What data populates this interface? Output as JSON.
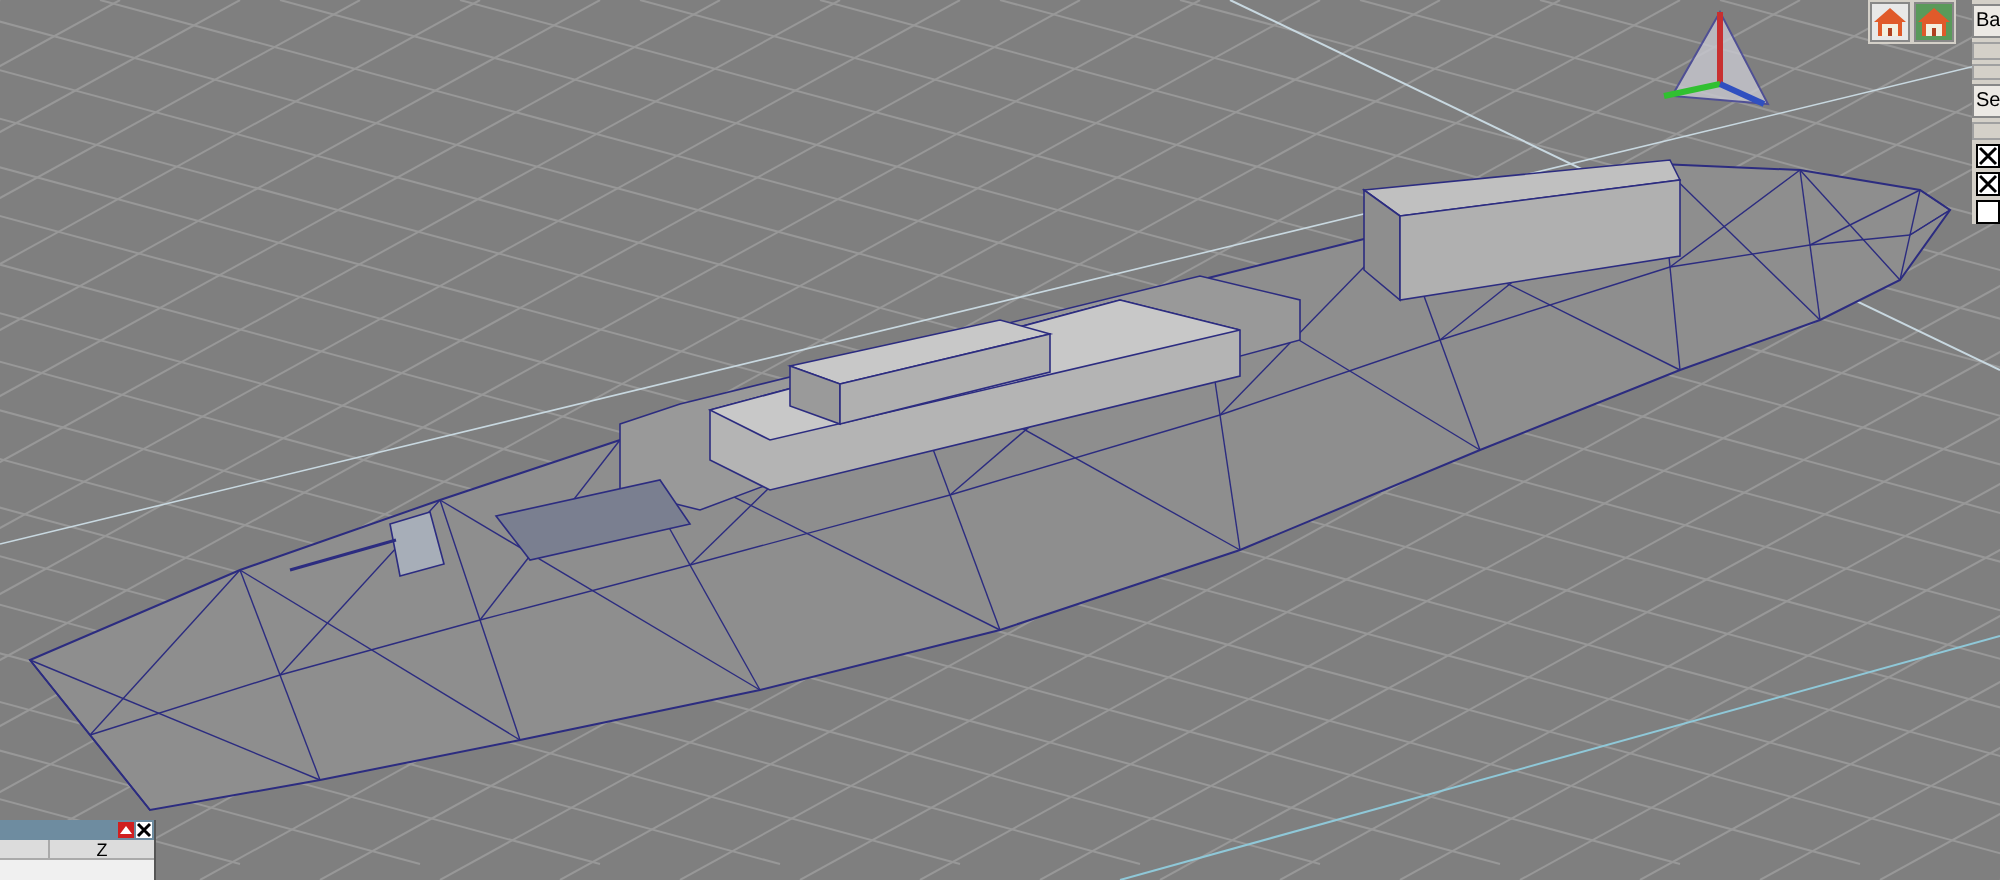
{
  "side_panel": {
    "items": [
      {
        "kind": "button",
        "label": "Ba"
      },
      {
        "kind": "blank"
      },
      {
        "kind": "blank"
      },
      {
        "kind": "button",
        "label": "Se"
      },
      {
        "kind": "blank"
      },
      {
        "kind": "checkbox",
        "checked": true
      },
      {
        "kind": "checkbox",
        "checked": true
      },
      {
        "kind": "checkbox",
        "checked": false
      }
    ]
  },
  "float_panel": {
    "columns": [
      "Z"
    ]
  }
}
